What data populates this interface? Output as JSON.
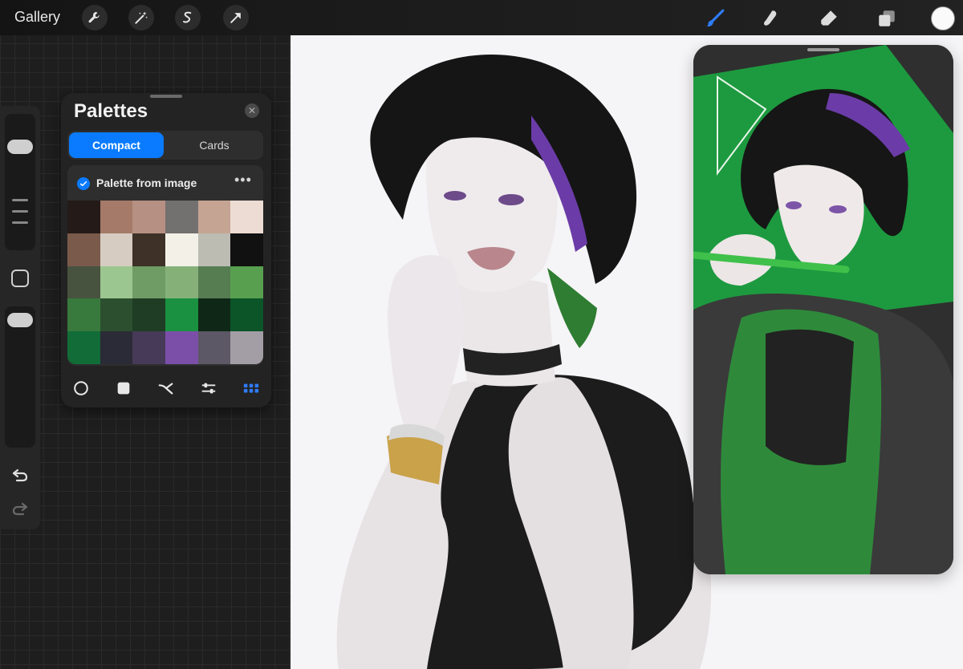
{
  "topbar": {
    "gallery_label": "Gallery",
    "left_tools": [
      "wrench-icon",
      "magic-wand-icon",
      "selection-icon",
      "transform-arrow-icon"
    ],
    "right_tools": [
      "brush-icon",
      "smudge-icon",
      "eraser-icon",
      "layers-icon"
    ],
    "active_tool": "brush-icon",
    "active_color": "#fafafa"
  },
  "sidebar": {
    "controls": [
      "brush-size-slider",
      "modifier-button",
      "opacity-slider",
      "undo-icon",
      "redo-icon"
    ]
  },
  "palettes_panel": {
    "title": "Palettes",
    "tabs": [
      {
        "label": "Compact",
        "active": true
      },
      {
        "label": "Cards",
        "active": false
      }
    ],
    "palette": {
      "name": "Palette from image",
      "default": true,
      "swatches": [
        "#241a18",
        "#a57a68",
        "#b69082",
        "#737070",
        "#c5a494",
        "#ecdcd3",
        "#7a5a4a",
        "#d6ccc2",
        "#3d3128",
        "#f3f0e7",
        "#bcbcb2",
        "#111111",
        "#47523f",
        "#9cc68f",
        "#6f9c65",
        "#85b179",
        "#567d52",
        "#58a04f",
        "#387a3d",
        "#2c4f2f",
        "#1f3c24",
        "#1a9140",
        "#0f2716",
        "#0b5528",
        "#116c37",
        "#2b2b37",
        "#463a58",
        "#7b4fa8",
        "#5c5866",
        "#a39da6"
      ]
    },
    "bottom_icons": [
      "disc-icon",
      "square-icon",
      "harmony-icon",
      "value-sliders-icon",
      "palettes-grid-icon"
    ],
    "active_bottom_icon": "palettes-grid-icon"
  },
  "canvas": {
    "content": "artwork"
  },
  "reference_window": {
    "content": "reference-image"
  }
}
